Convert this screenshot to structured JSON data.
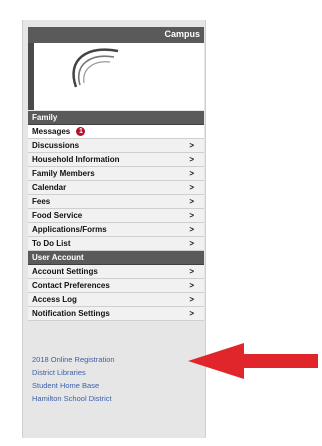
{
  "header": {
    "title": "Campus"
  },
  "menu": {
    "family_section": "Family",
    "messages": {
      "label": "Messages",
      "badge": "1"
    },
    "family_items": [
      {
        "label": "Discussions",
        "arrow": ">"
      },
      {
        "label": "Household Information",
        "arrow": ">"
      },
      {
        "label": "Family Members",
        "arrow": ">"
      },
      {
        "label": "Calendar",
        "arrow": ">"
      },
      {
        "label": "Fees",
        "arrow": ">"
      },
      {
        "label": "Food Service",
        "arrow": ">"
      },
      {
        "label": "Applications/Forms",
        "arrow": ">"
      },
      {
        "label": "To Do List",
        "arrow": ">"
      }
    ],
    "account_section": "User Account",
    "account_items": [
      {
        "label": "Account Settings",
        "arrow": ">"
      },
      {
        "label": "Contact Preferences",
        "arrow": ">"
      },
      {
        "label": "Access Log",
        "arrow": ">"
      },
      {
        "label": "Notification Settings",
        "arrow": ">"
      }
    ]
  },
  "links": [
    "2018 Online Registration",
    "District Libraries",
    "Student Home Base",
    "Hamilton School District"
  ],
  "colors": {
    "header": "#5a5a5a",
    "link": "#3b5fa8",
    "badge": "#b3122a",
    "annotation_arrow": "#e0262a"
  }
}
